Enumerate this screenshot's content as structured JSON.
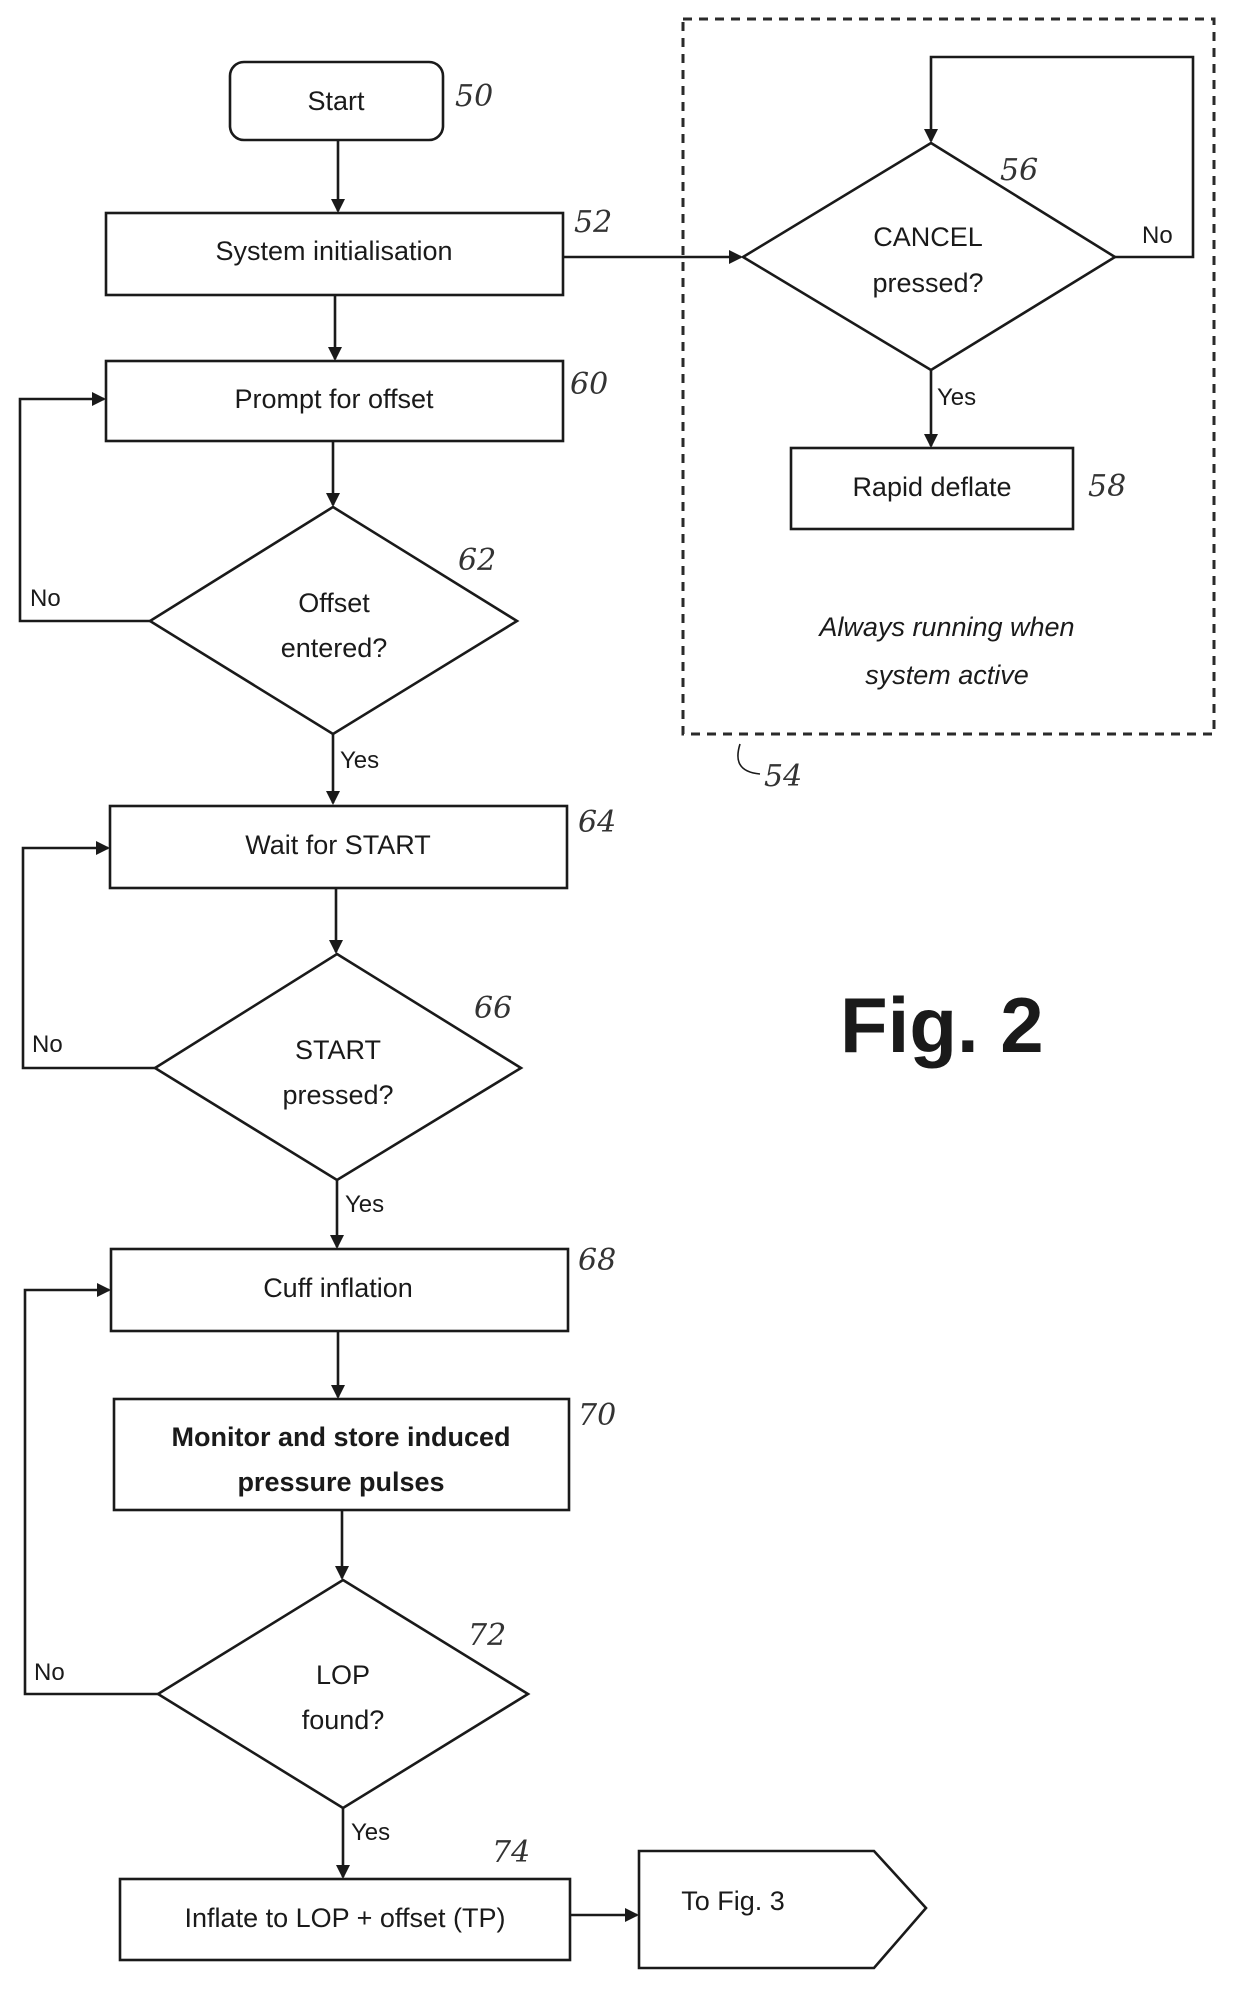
{
  "figure": {
    "title": "Fig. 2",
    "nodes": {
      "start": {
        "text": "Start",
        "ref": "50"
      },
      "system_init": {
        "text": "System initialisation",
        "ref": "52"
      },
      "prompt_offset": {
        "text": "Prompt for offset",
        "ref": "60"
      },
      "offset_entered": {
        "line1": "Offset",
        "line2": "entered?",
        "ref": "62"
      },
      "wait_start": {
        "text": "Wait for START",
        "ref": "64"
      },
      "start_pressed": {
        "line1": "START",
        "line2": "pressed?",
        "ref": "66"
      },
      "cuff_inflation": {
        "text": "Cuff inflation",
        "ref": "68"
      },
      "monitor_store": {
        "line1": "Monitor and store induced",
        "line2": "pressure pulses",
        "ref": "70"
      },
      "lop_found": {
        "line1": "LOP",
        "line2": "found?",
        "ref": "72"
      },
      "inflate_tp": {
        "text": "Inflate to LOP + offset (TP)",
        "ref": "74"
      },
      "to_fig3": {
        "text": "To Fig. 3"
      },
      "cancel_pressed": {
        "line1": "CANCEL",
        "line2": "pressed?",
        "ref": "56"
      },
      "rapid_deflate": {
        "text": "Rapid deflate",
        "ref": "58"
      }
    },
    "background_process": {
      "ref": "54",
      "note_line1": "Always running when",
      "note_line2": "system active"
    },
    "edge_labels": {
      "yes": "Yes",
      "no": "No"
    }
  }
}
